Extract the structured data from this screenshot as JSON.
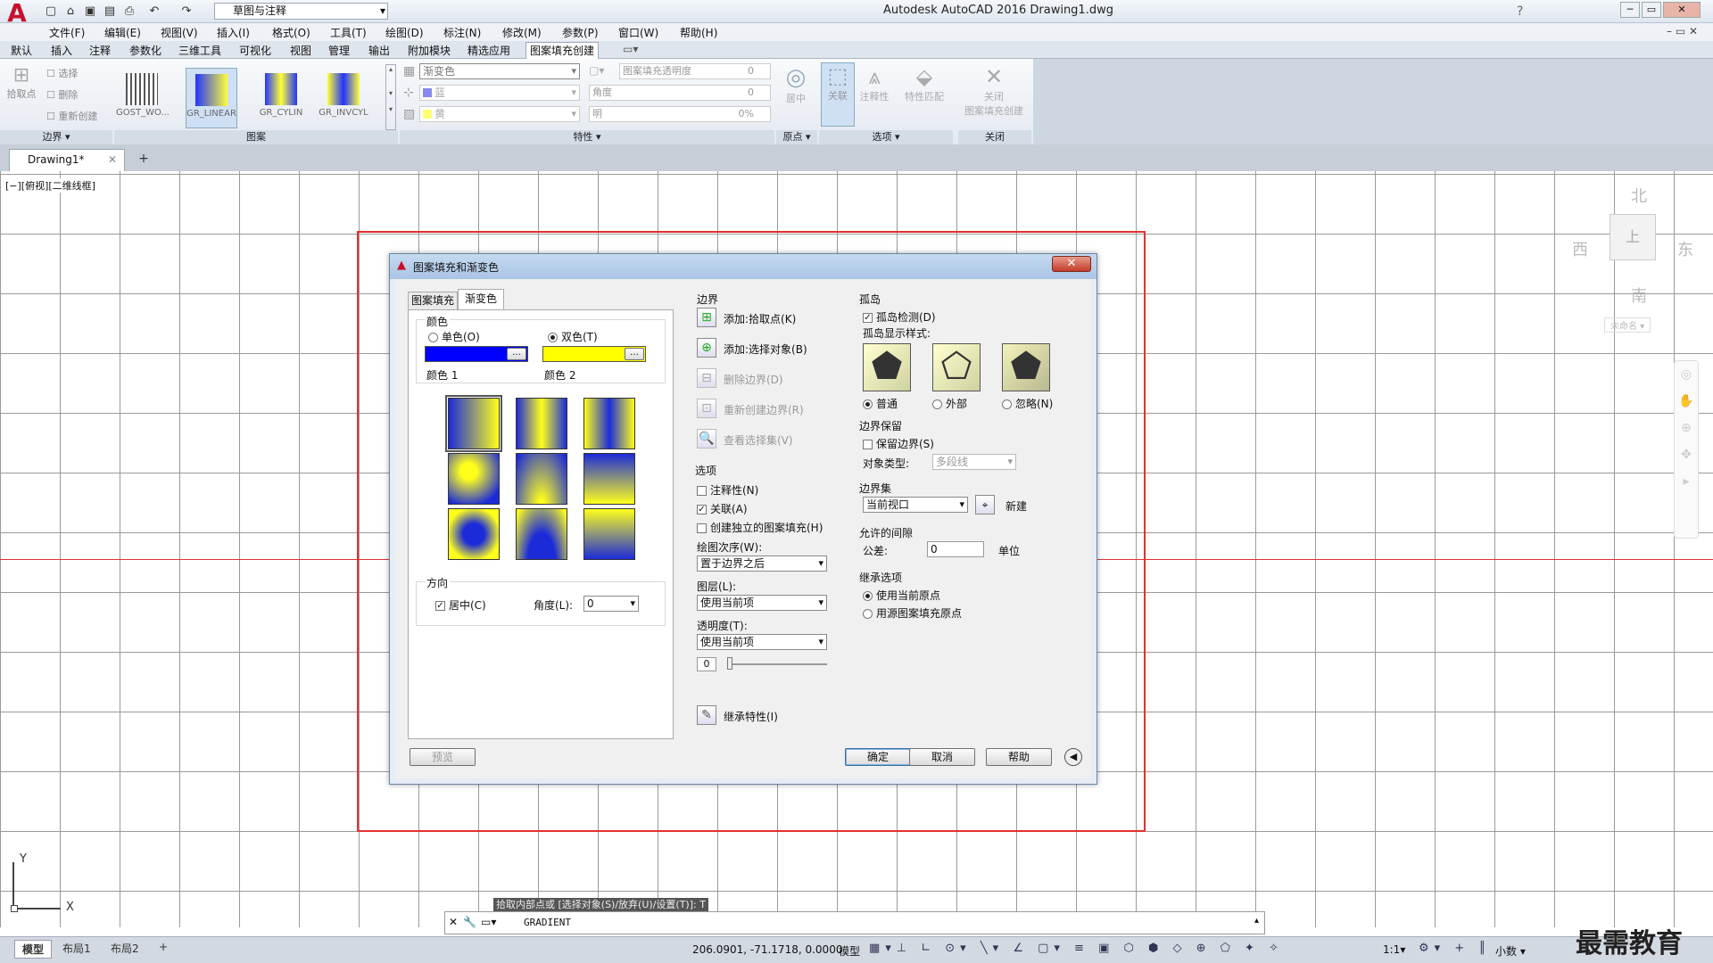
{
  "app": {
    "logo": "A",
    "title": "Autodesk AutoCAD 2016    Drawing1.dwg",
    "workspace": "草图与注释"
  },
  "menu": [
    "文件(F)",
    "编辑(E)",
    "视图(V)",
    "插入(I)",
    "格式(O)",
    "工具(T)",
    "绘图(D)",
    "标注(N)",
    "修改(M)",
    "参数(P)",
    "窗口(W)",
    "帮助(H)"
  ],
  "ribbon_tabs": [
    "默认",
    "插入",
    "注释",
    "参数化",
    "三维工具",
    "可视化",
    "视图",
    "管理",
    "输出",
    "附加模块",
    "精选应用",
    "图案填充创建"
  ],
  "ribbon": {
    "boundary": {
      "pick": "拾取点",
      "select": "选择",
      "remove": "删除",
      "recreate": "重新创建",
      "label": "边界"
    },
    "patterns": [
      "GOST_WO...",
      "GR_LINEAR",
      "GR_CYLIN",
      "GR_INVCYL"
    ],
    "pattern_label": "图案",
    "props": {
      "type": "渐变色",
      "color1": "蓝",
      "color2": "黄",
      "transparency_label": "图案填充透明度",
      "transparency": "0",
      "angle_label": "角度",
      "angle": "0",
      "tint_label": "明",
      "tint": "0%",
      "label": "特性"
    },
    "origin": {
      "center": "居中",
      "label": "原点"
    },
    "options": {
      "assoc": "关联",
      "annot": "注释性",
      "match": "特性匹配",
      "label": "选项"
    },
    "close": {
      "btn": "关闭\n图案填充创建",
      "label": "关闭"
    }
  },
  "doc_tab": "Drawing1*",
  "viewport_label": "[−][俯视][二维线框]",
  "viewcube": {
    "n": "北",
    "s": "南",
    "e": "东",
    "w": "西",
    "top": "上",
    "wcs": "未命名"
  },
  "dialog": {
    "title": "图案填充和渐变色",
    "tabs": [
      "图案填充",
      "渐变色"
    ],
    "color_group": "颜色",
    "one_color": "单色(O)",
    "two_color": "双色(T)",
    "color1_label": "颜色 1",
    "color2_label": "颜色 2",
    "color1": "#0000ff",
    "color2": "#ffff00",
    "orientation": "方向",
    "centered": "居中(C)",
    "angle_label": "角度(L):",
    "angle": "0",
    "preview": "预览",
    "boundaries": "边界",
    "b_add_pick": "添加:拾取点(K)",
    "b_add_select": "添加:选择对象(B)",
    "b_remove": "删除边界(D)",
    "b_recreate": "重新创建边界(R)",
    "b_view": "查看选择集(V)",
    "options": "选项",
    "o_annot": "注释性(N)",
    "o_assoc": "关联(A)",
    "o_separate": "创建独立的图案填充(H)",
    "draw_order_label": "绘图次序(W):",
    "draw_order": "置于边界之后",
    "layer_label": "图层(L):",
    "layer": "使用当前项",
    "transp_label": "透明度(T):",
    "transp": "使用当前项",
    "transp_val": "0",
    "inherit": "继承特性(I)",
    "islands": "孤岛",
    "island_detect": "孤岛检测(D)",
    "island_style": "孤岛显示样式:",
    "island_normal": "普通",
    "island_outer": "外部",
    "island_ignore": "忽略(N)",
    "retain": "边界保留",
    "retain_chk": "保留边界(S)",
    "obj_type_label": "对象类型:",
    "obj_type": "多段线",
    "bset": "边界集",
    "bset_val": "当前视口",
    "bset_new": "新建",
    "gap": "允许的间隙",
    "tol_label": "公差:",
    "tol": "0",
    "unit": "单位",
    "inherit_opts": "继承选项",
    "inh_current": "使用当前原点",
    "inh_source": "用源图案填充原点",
    "ok": "确定",
    "cancel": "取消",
    "help": "帮助"
  },
  "command": {
    "hint": "拾取内部点或 [选择对象(S)/放弃(U)/设置(T)]: T",
    "text": "GRADIENT"
  },
  "status": {
    "tabs": [
      "模型",
      "布局1",
      "布局2"
    ],
    "coords": "206.0901, -71.1718, 0.0000",
    "mode": "模型",
    "scale": "1:1",
    "units": "小数",
    "watermark": "最需教育"
  }
}
